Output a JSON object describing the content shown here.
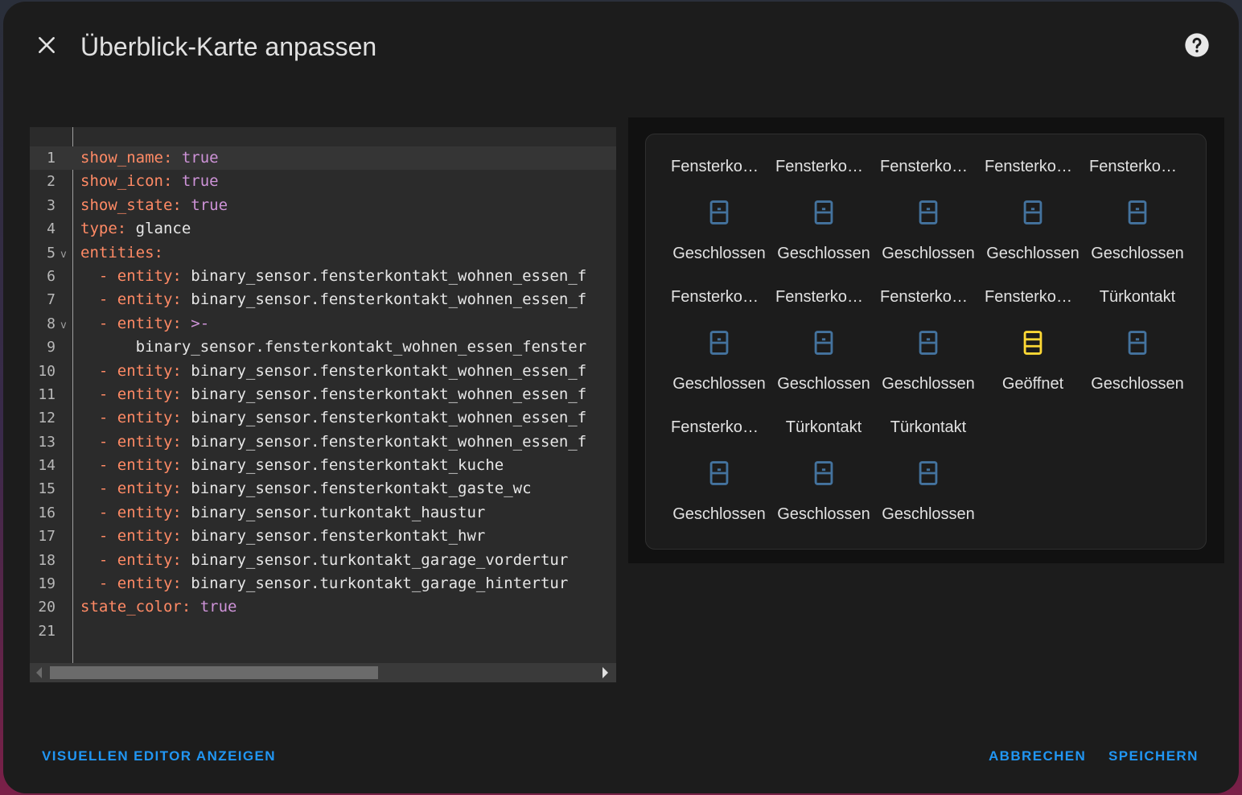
{
  "dialog": {
    "title": "Überblick-Karte anpassen",
    "icons": {
      "close": "close-icon",
      "help": "help-circle-icon"
    }
  },
  "editor": {
    "lines": [
      {
        "n": "1",
        "key": "show_name",
        "value": "true",
        "indent": "",
        "fold": ""
      },
      {
        "n": "2",
        "key": "show_icon",
        "value": "true",
        "indent": "",
        "fold": ""
      },
      {
        "n": "3",
        "key": "show_state",
        "value": "true",
        "indent": "",
        "fold": ""
      },
      {
        "n": "4",
        "key": "type",
        "value": "glance",
        "indent": "",
        "fold": ""
      },
      {
        "n": "5",
        "key": "entities",
        "value": "",
        "indent": "",
        "fold": "v"
      },
      {
        "n": "6",
        "key": "entity",
        "value": "binary_sensor.fensterkontakt_wohnen_essen_f",
        "indent": "  - ",
        "fold": ""
      },
      {
        "n": "7",
        "key": "entity",
        "value": "binary_sensor.fensterkontakt_wohnen_essen_f",
        "indent": "  - ",
        "fold": ""
      },
      {
        "n": "8",
        "key": "entity",
        "value": ">-",
        "indent": "  - ",
        "fold": "v"
      },
      {
        "n": "9",
        "key": "",
        "value": "binary_sensor.fensterkontakt_wohnen_essen_fenster",
        "indent": "      ",
        "fold": ""
      },
      {
        "n": "10",
        "key": "entity",
        "value": "binary_sensor.fensterkontakt_wohnen_essen_f",
        "indent": "  - ",
        "fold": ""
      },
      {
        "n": "11",
        "key": "entity",
        "value": "binary_sensor.fensterkontakt_wohnen_essen_f",
        "indent": "  - ",
        "fold": ""
      },
      {
        "n": "12",
        "key": "entity",
        "value": "binary_sensor.fensterkontakt_wohnen_essen_f",
        "indent": "  - ",
        "fold": ""
      },
      {
        "n": "13",
        "key": "entity",
        "value": "binary_sensor.fensterkontakt_wohnen_essen_f",
        "indent": "  - ",
        "fold": ""
      },
      {
        "n": "14",
        "key": "entity",
        "value": "binary_sensor.fensterkontakt_kuche",
        "indent": "  - ",
        "fold": ""
      },
      {
        "n": "15",
        "key": "entity",
        "value": "binary_sensor.fensterkontakt_gaste_wc",
        "indent": "  - ",
        "fold": ""
      },
      {
        "n": "16",
        "key": "entity",
        "value": "binary_sensor.turkontakt_haustur",
        "indent": "  - ",
        "fold": ""
      },
      {
        "n": "17",
        "key": "entity",
        "value": "binary_sensor.fensterkontakt_hwr",
        "indent": "  - ",
        "fold": ""
      },
      {
        "n": "18",
        "key": "entity",
        "value": "binary_sensor.turkontakt_garage_vordertur",
        "indent": "  - ",
        "fold": ""
      },
      {
        "n": "19",
        "key": "entity",
        "value": "binary_sensor.turkontakt_garage_hintertur",
        "indent": "  - ",
        "fold": ""
      },
      {
        "n": "20",
        "key": "state_color",
        "value": "true",
        "indent": "",
        "fold": ""
      },
      {
        "n": "21",
        "key": "",
        "value": "",
        "indent": "",
        "fold": ""
      }
    ]
  },
  "preview": {
    "entities": [
      {
        "name": "Fensterkontakt",
        "state": "Geschlossen",
        "open": false
      },
      {
        "name": "Fensterkontakt",
        "state": "Geschlossen",
        "open": false
      },
      {
        "name": "Fensterkontakt",
        "state": "Geschlossen",
        "open": false
      },
      {
        "name": "Fensterkontakt",
        "state": "Geschlossen",
        "open": false
      },
      {
        "name": "Fensterkontakt",
        "state": "Geschlossen",
        "open": false
      },
      {
        "name": "Fensterkontakt",
        "state": "Geschlossen",
        "open": false
      },
      {
        "name": "Fensterkontakt",
        "state": "Geschlossen",
        "open": false
      },
      {
        "name": "Fensterkontakt",
        "state": "Geschlossen",
        "open": false
      },
      {
        "name": "Fensterkontakt",
        "state": "Geöffnet",
        "open": true
      },
      {
        "name": "Türkontakt",
        "state": "Geschlossen",
        "open": false
      },
      {
        "name": "Fensterkontakt",
        "state": "Geschlossen",
        "open": false
      },
      {
        "name": "Türkontakt",
        "state": "Geschlossen",
        "open": false
      },
      {
        "name": "Türkontakt",
        "state": "Geschlossen",
        "open": false
      }
    ],
    "colors": {
      "closed": "#44739e",
      "open": "#fdd835"
    }
  },
  "footer": {
    "visual_editor": "Visuellen Editor anzeigen",
    "cancel": "Abbrechen",
    "save": "Speichern"
  }
}
